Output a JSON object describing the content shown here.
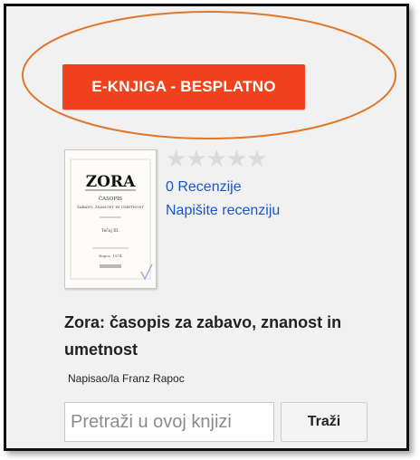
{
  "ebook_button": {
    "label": "E-KNJIGA - BESPLATNO"
  },
  "cover": {
    "title": "ZORA",
    "subtitle": "ČASOPIS",
    "line1": "ZABAVO, ZNANOST IN UMETNOST",
    "line2": "Tečaj III.",
    "line3": "Rapoc, 1874"
  },
  "rating": {
    "stars": "★★★★★",
    "filled": 0
  },
  "reviews": {
    "count_label": "0 Recenzije",
    "write_label": "Napišite recenziju"
  },
  "book": {
    "title": "Zora: časopis za zabavo, znanost in umetnost",
    "author": "Napisao/la Franz Rapoc"
  },
  "search": {
    "placeholder": "Pretraži u ovoj knjizi",
    "button_label": "Traži"
  },
  "colors": {
    "accent": "#f0421c",
    "link": "#1a56c7",
    "annotation": "#e0772a"
  }
}
